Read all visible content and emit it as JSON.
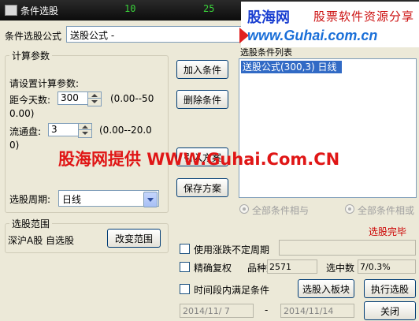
{
  "window": {
    "title": "条件选股",
    "tickers": [
      "10",
      "25"
    ]
  },
  "watermark": {
    "brand": "股海网",
    "slogan": "股票软件资源分享",
    "url": "www.Guhai.com.cn",
    "overlay_text": "股海网提供 WWW.Guhai.Com.CN"
  },
  "formula": {
    "label": "条件选股公式",
    "value": "送股公式 -"
  },
  "params": {
    "group_label": "计算参数",
    "prompt": "请设置计算参数:",
    "days": {
      "label": "距今天数:",
      "value": "300",
      "range_line1": "(0.00--50",
      "range_line2": "0.00)"
    },
    "float": {
      "label": "流通盘:",
      "value": "3",
      "range_line1": "(0.00--20.0",
      "range_line2": "0)"
    },
    "period": {
      "label": "选股周期:",
      "value": "日线"
    }
  },
  "scope": {
    "group_label": "选股范围",
    "value": "深沪A股 自选股",
    "change_button": "改变范围"
  },
  "buttons": {
    "add_condition": "加入条件",
    "delete_condition": "删除条件",
    "read_plan": "引入方案",
    "save_plan": "保存方案",
    "add_to_block": "选股入板块",
    "execute": "执行选股",
    "close": "关闭"
  },
  "condition_list": {
    "label": "选股条件列表",
    "items": [
      "送股公式(300,3) 日线"
    ]
  },
  "logic": {
    "and_label": "全部条件相与",
    "or_label": "全部条件相或"
  },
  "status": {
    "text": "选股完毕",
    "color": "#cc0000"
  },
  "options": {
    "uncertain_period": "使用涨跌不定周期",
    "precise_rights": "精确复权",
    "time_condition": "时间段内满足条件"
  },
  "stats": {
    "count_label": "品种数",
    "count_value": "2571",
    "selected_label": "选中数",
    "selected_value": "7/0.3%"
  },
  "date_range": {
    "from": "2014/11/ 7",
    "separator": "-",
    "to": "2014/11/14"
  }
}
